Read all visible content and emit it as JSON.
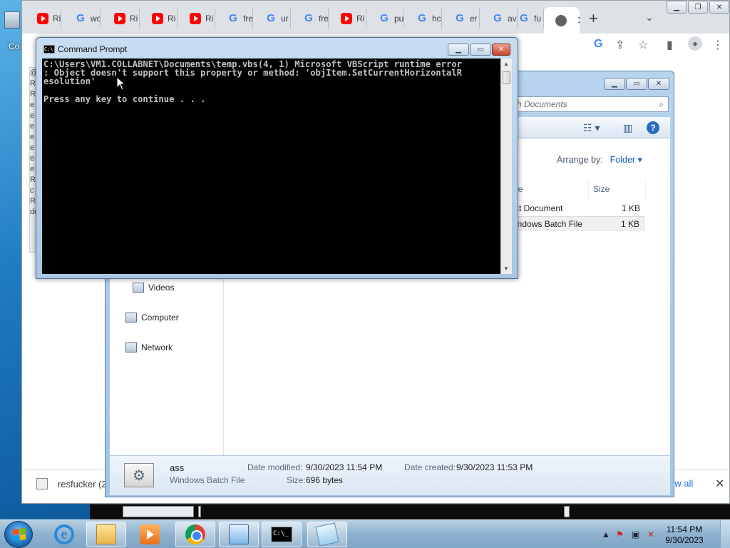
{
  "desktop": {
    "icons": [
      {
        "label": "Co"
      }
    ]
  },
  "chrome": {
    "tabs": [
      {
        "favicon": "youtube-icon",
        "label": "Ri"
      },
      {
        "favicon": "google-icon",
        "label": "wc"
      },
      {
        "favicon": "youtube-icon",
        "label": "Ri"
      },
      {
        "favicon": "youtube-icon",
        "label": "Ri"
      },
      {
        "favicon": "youtube-icon",
        "label": "Ri"
      },
      {
        "favicon": "google-icon",
        "label": "fre"
      },
      {
        "favicon": "google-icon",
        "label": "ur"
      },
      {
        "favicon": "google-icon",
        "label": "fre"
      },
      {
        "favicon": "youtube-icon",
        "label": "Ri"
      },
      {
        "favicon": "google-icon",
        "label": "pu"
      },
      {
        "favicon": "google-icon",
        "label": "hc"
      },
      {
        "favicon": "google-icon",
        "label": "er"
      },
      {
        "favicon": "google-icon",
        "label": "av"
      },
      {
        "favicon": "google-icon",
        "label": "fu"
      }
    ],
    "active_tab": {
      "favicon": "globe-icon",
      "close": "✕"
    },
    "new_tab": "+",
    "tab_search": "⌄",
    "page_side_text": "@ R R e e e e e e e R c R de",
    "download_bar": {
      "item_label": "resfucker (2",
      "show_all": "ow all",
      "close": "✕"
    }
  },
  "explorer": {
    "search_placeholder": "rch Documents",
    "arrange_label": "Arrange by:",
    "arrange_value": "Folder",
    "columns": {
      "type": "pe",
      "size": "Size"
    },
    "files": [
      {
        "type": "xt Document",
        "size": "1 KB",
        "selected": false
      },
      {
        "type": "indows Batch File",
        "size": "1 KB",
        "selected": true
      }
    ],
    "nav": [
      {
        "icon": "videos-icon",
        "label": "Videos"
      },
      {
        "icon": "computer-icon",
        "label": "Computer"
      },
      {
        "icon": "network-icon",
        "label": "Network"
      }
    ],
    "details": {
      "name": "ass",
      "type": "Windows Batch File",
      "modified_label": "Date modified:",
      "modified_value": "9/30/2023 11:54 PM",
      "created_label": "Date created:",
      "created_value": "9/30/2023 11:53 PM",
      "size_label": "Size:",
      "size_value": "696 bytes"
    }
  },
  "cmd": {
    "title": "Command Prompt",
    "output": "C:\\Users\\VM1.COLLABNET\\Documents\\temp.vbs(4, 1) Microsoft VBScript runtime error\n: Object doesn't support this property or method: 'objItem.SetCurrentHorizontalR\nesolution'\n\nPress any key to continue . . ."
  },
  "taskbar": {
    "apps": [
      {
        "name": "internet-explorer",
        "open": false
      },
      {
        "name": "file-explorer",
        "open": true
      },
      {
        "name": "media-player",
        "open": false
      },
      {
        "name": "google-chrome",
        "open": true
      },
      {
        "name": "control-panel",
        "open": true
      },
      {
        "name": "command-prompt",
        "open": true
      },
      {
        "name": "notepad",
        "open": true
      }
    ],
    "clock_time": "11:54 PM",
    "clock_date": "9/30/2023"
  }
}
